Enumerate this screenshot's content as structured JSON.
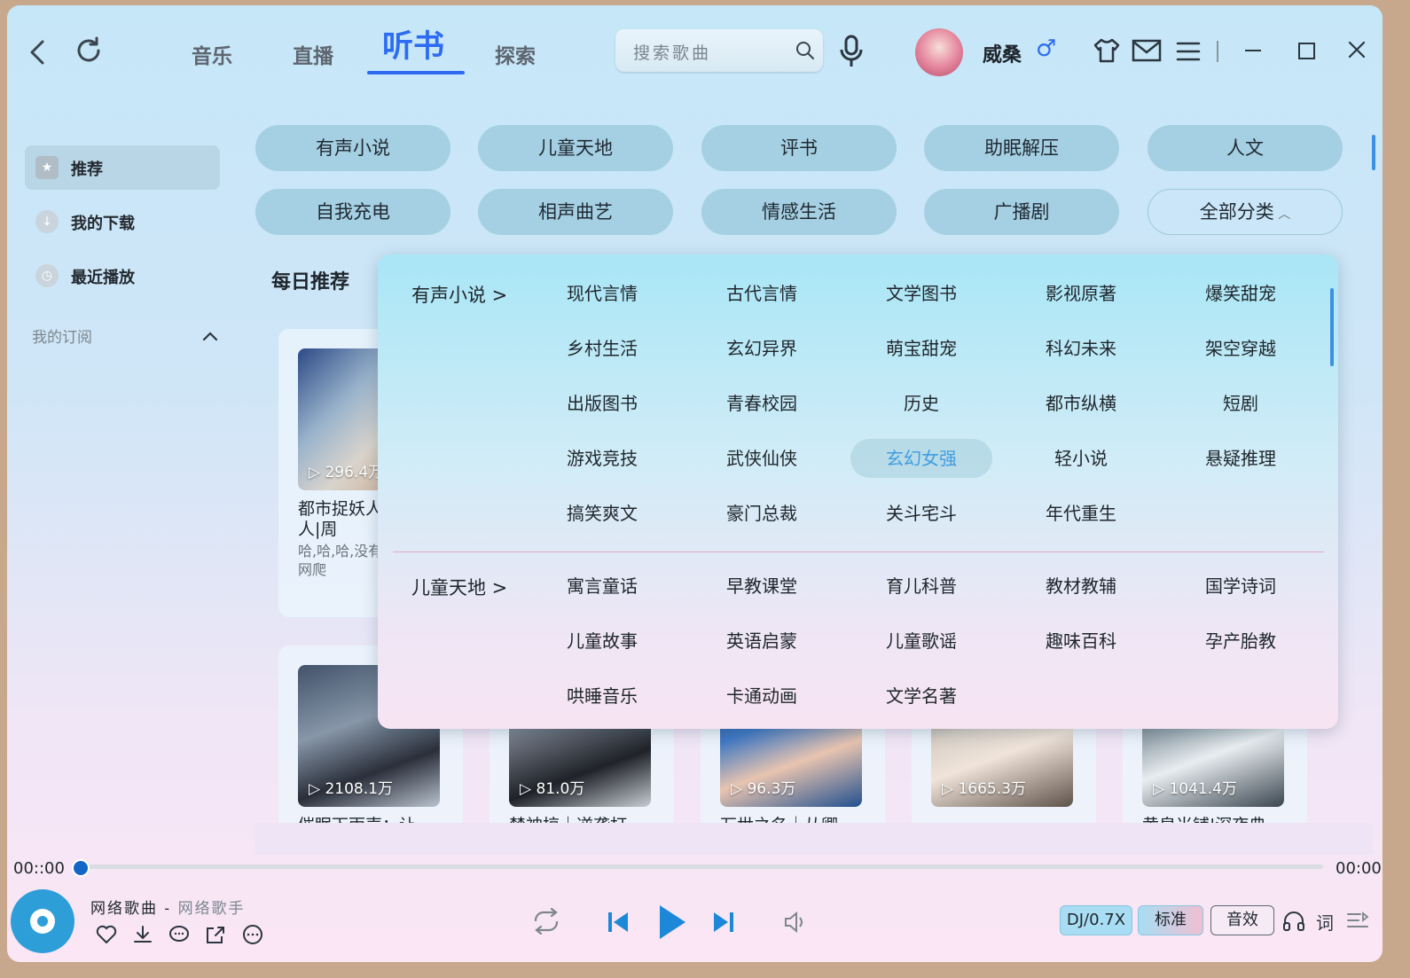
{
  "header": {
    "tabs": [
      {
        "label": "音乐"
      },
      {
        "label": "直播"
      },
      {
        "label": "听书",
        "active": true
      },
      {
        "label": "探索"
      }
    ],
    "search_placeholder": "搜索歌曲",
    "username": "威桑",
    "gender_symbol": "♂"
  },
  "sidebar": {
    "items": [
      {
        "label": "推荐",
        "active": true
      },
      {
        "label": "我的下载"
      },
      {
        "label": "最近播放"
      }
    ],
    "subscriptions_label": "我的订阅"
  },
  "categories": {
    "row1": [
      "有声小说",
      "儿童天地",
      "评书",
      "助眠解压",
      "人文"
    ],
    "row2": [
      "自我充电",
      "相声曲艺",
      "情感生活",
      "广播剧"
    ],
    "all_label": "全部分类"
  },
  "daily": {
    "title": "每日推荐",
    "cards_row1": [
      {
        "plays": "296.4万",
        "title": "都市捉妖人|捉鬼人|周",
        "desc": "哈,哈,哈,没有本哦,官网爬"
      }
    ],
    "cards_row2": [
      {
        "plays": "2108.1万",
        "title": "催眠下雨声：让"
      },
      {
        "plays": "81.0万",
        "title": "禁神掠｜逆袭打"
      },
      {
        "plays": "96.3万",
        "title": "万世之名｜从卿"
      },
      {
        "plays": "1665.3万",
        "title": ""
      },
      {
        "plays": "1041.4万",
        "title": "黄泉当铺|深夜典"
      }
    ]
  },
  "dropdown": {
    "sections": [
      {
        "heading": "有声小说 >",
        "items": [
          "现代言情",
          "古代言情",
          "文学图书",
          "影视原著",
          "爆笑甜宠",
          "乡村生活",
          "玄幻异界",
          "萌宝甜宠",
          "科幻未来",
          "架空穿越",
          "出版图书",
          "青春校园",
          "历史",
          "都市纵横",
          "短剧",
          "游戏竞技",
          "武侠仙侠",
          "玄幻女强",
          "轻小说",
          "悬疑推理",
          "搞笑爽文",
          "豪门总裁",
          "关斗宅斗",
          "年代重生"
        ],
        "active": "玄幻女强"
      },
      {
        "heading": "儿童天地 >",
        "items": [
          "寓言童话",
          "早教课堂",
          "育儿科普",
          "教材教辅",
          "国学诗词",
          "儿童故事",
          "英语启蒙",
          "儿童歌谣",
          "趣味百科",
          "孕产胎教",
          "哄睡音乐",
          "卡通动画",
          "文学名著"
        ]
      }
    ]
  },
  "player": {
    "current_time": "00::00",
    "total_time": "00:00",
    "progress": 0,
    "song_title": "网络歌曲",
    "separator": " - ",
    "artist": "网络歌手",
    "speed_label": "DJ/0.7X",
    "quality_label": "标准",
    "effects_label": "音效",
    "lyrics_label": "词"
  },
  "colors": {
    "accent": "#2d6cf2",
    "pill": "#a5cfe2",
    "active_item_text": "#3f9de0"
  }
}
